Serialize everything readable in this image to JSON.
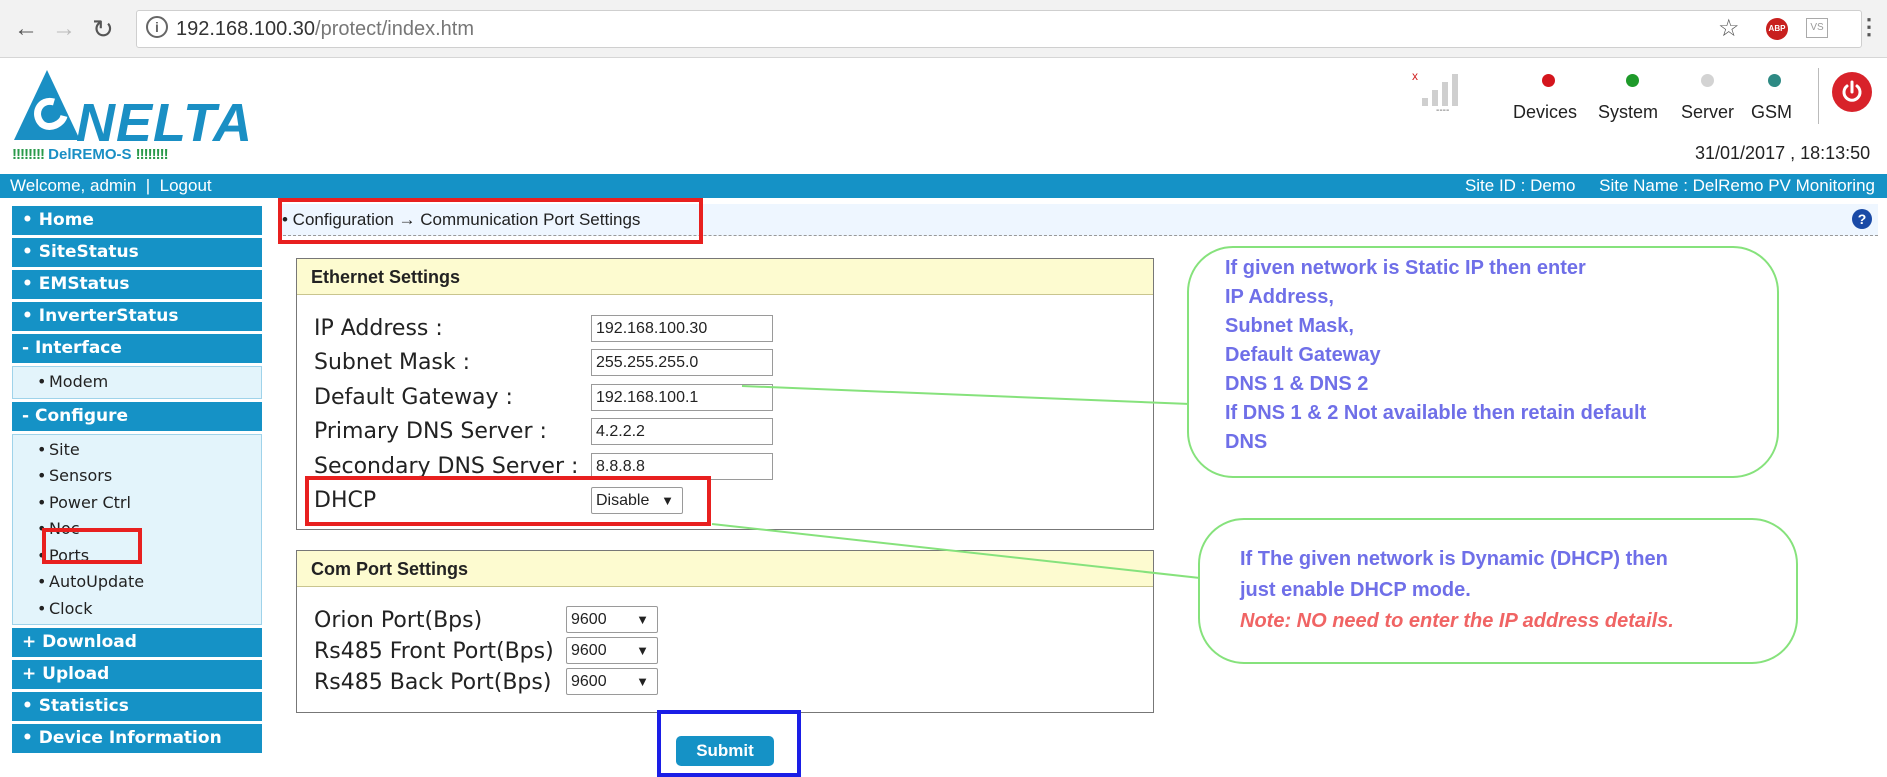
{
  "browser": {
    "url_host": "192.168.100.30",
    "url_path": "/protect/index.htm"
  },
  "logo": {
    "brand": "NELTA",
    "product": "DelREMO-S",
    "dots": "!!!!!!!!"
  },
  "status": {
    "signal_caption": "----",
    "indicators": [
      {
        "label": "Devices",
        "color": "#d4151d"
      },
      {
        "label": "System",
        "color": "#1e9a2a"
      },
      {
        "label": "Server",
        "color": "#d3d3d3"
      },
      {
        "label": "GSM",
        "color": "#2e8a84"
      }
    ],
    "datetime": "31/01/2017 ,  18:13:50"
  },
  "topbar": {
    "welcome": "Welcome, admin",
    "separator": "|",
    "logout": "Logout",
    "site_id": "Site ID : Demo",
    "site_name": "Site Name : DelRemo PV Monitoring"
  },
  "sidebar": {
    "home": "• Home",
    "sitestatus": "• SiteStatus",
    "emstatus": "• EMStatus",
    "inverterstatus": "• InverterStatus",
    "interface": "- Interface",
    "modem": "Modem",
    "configure": "- Configure",
    "site": "Site",
    "sensors": "Sensors",
    "powerctrl": "Power Ctrl",
    "noc": "Noc",
    "ports": "Ports",
    "autoupdate": "AutoUpdate",
    "clock": "Clock",
    "download": "+ Download",
    "upload": "+ Upload",
    "statistics": "• Statistics",
    "deviceinfo": "• Device Information"
  },
  "breadcrumb": "•  Configuration → Communication Port Settings",
  "ethernet": {
    "title": "Ethernet Settings",
    "ip_label": "IP Address :",
    "ip_value": "192.168.100.30",
    "subnet_label": "Subnet Mask :",
    "subnet_value": "255.255.255.0",
    "gateway_label": "Default Gateway :",
    "gateway_value": "192.168.100.1",
    "dns1_label": "Primary DNS Server :",
    "dns1_value": "4.2.2.2",
    "dns2_label": "Secondary DNS Server :",
    "dns2_value": "8.8.8.8",
    "dhcp_label": "DHCP",
    "dhcp_value": "Disable"
  },
  "comport": {
    "title": "Com Port Settings",
    "orion_label": "Orion Port(Bps)",
    "orion_value": "9600",
    "front_label": "Rs485 Front Port(Bps)",
    "front_value": "9600",
    "back_label": "Rs485 Back Port(Bps)",
    "back_value": "9600"
  },
  "submit_label": "Submit",
  "callout1": {
    "lines": [
      "If given network is Static IP then enter",
      "IP Address,",
      "Subnet Mask,",
      "Default Gateway",
      "DNS 1 & DNS  2",
      "If DNS 1 &  2 Not available then retain default",
      "DNS"
    ]
  },
  "callout2": {
    "line1": "If The given network is Dynamic (DHCP) then",
    "line2": "just enable DHCP mode.",
    "note": "Note: NO need to enter the IP address details."
  }
}
